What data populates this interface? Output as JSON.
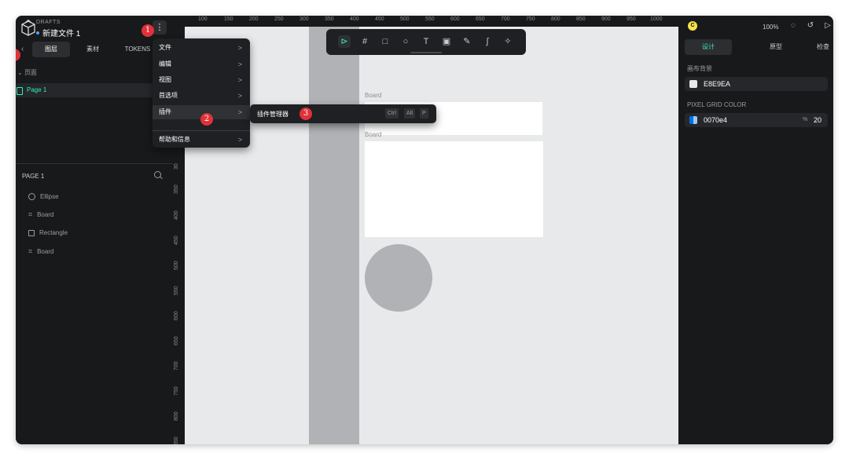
{
  "colors": {
    "accent": "#31efb8",
    "badge": "#e0313a",
    "canvas_bg": "#e8e9ea",
    "pixel_grid": "#0070e4"
  },
  "file": {
    "section": "DRAFTS",
    "name": "新建文件 1"
  },
  "menu_button": {
    "icon": "⋮"
  },
  "badges": [
    "1",
    "2",
    "3"
  ],
  "left_tabs": [
    {
      "label": "图层",
      "active": true
    },
    {
      "label": "素材",
      "active": false
    },
    {
      "label": "TOKENS",
      "active": false
    }
  ],
  "pages": {
    "header": "页面",
    "items": [
      {
        "label": "Page 1",
        "active": true
      }
    ]
  },
  "layers": {
    "title": "PAGE 1",
    "items": [
      {
        "label": "Ellipse",
        "icon": "ellipse-icon"
      },
      {
        "label": "Board",
        "icon": "board-icon"
      },
      {
        "label": "Rectangle",
        "icon": "rectangle-icon"
      },
      {
        "label": "Board",
        "icon": "board-icon"
      }
    ]
  },
  "ruler": {
    "top": [
      "100",
      "150",
      "200",
      "250",
      "300",
      "350",
      "400",
      "450",
      "500",
      "550",
      "600",
      "650",
      "700",
      "750",
      "800",
      "850",
      "900",
      "950",
      "1000"
    ],
    "left": [
      "30",
      "350",
      "400",
      "450",
      "500",
      "550",
      "600",
      "650",
      "700",
      "750",
      "800",
      "850"
    ]
  },
  "canvas": {
    "boards": [
      {
        "label": "Board"
      },
      {
        "label": "Board"
      }
    ]
  },
  "toolbar": {
    "tools": [
      {
        "icon": "pointer-icon",
        "glyph": "⊳",
        "active": true
      },
      {
        "icon": "board-icon",
        "glyph": "#"
      },
      {
        "icon": "rectangle-icon",
        "glyph": "□"
      },
      {
        "icon": "ellipse-icon",
        "glyph": "○"
      },
      {
        "icon": "text-icon",
        "glyph": "T"
      },
      {
        "icon": "image-icon",
        "glyph": "▣"
      },
      {
        "icon": "pencil-icon",
        "glyph": "✎"
      },
      {
        "icon": "path-icon",
        "glyph": "∫"
      },
      {
        "icon": "plugin-icon",
        "glyph": "✧"
      }
    ]
  },
  "main_menu": {
    "items": [
      {
        "label": "文件",
        "chevron": ">"
      },
      {
        "label": "编辑",
        "chevron": ">"
      },
      {
        "label": "视图",
        "chevron": ">"
      },
      {
        "label": "首选项",
        "chevron": ">"
      },
      {
        "label": "插件",
        "chevron": ">",
        "highlighted": true
      },
      {
        "label": "帮助和信息",
        "chevron": ">"
      }
    ]
  },
  "sub_menu": {
    "item": "插件管理器",
    "shortcut": [
      "Ctrl",
      "Alt",
      "P"
    ]
  },
  "right_panel": {
    "avatar": "C",
    "zoom": "100%",
    "tabs": [
      {
        "label": "设计",
        "active": true
      },
      {
        "label": "原型",
        "active": false
      },
      {
        "label": "检查",
        "active": false
      }
    ],
    "canvas_bg_label": "画布背景",
    "canvas_bg_value": "E8E9EA",
    "pixel_grid_label": "PIXEL GRID COLOR",
    "pixel_grid_value": "0070e4",
    "pixel_grid_pct_symbol": "%",
    "pixel_grid_opacity": "20"
  }
}
